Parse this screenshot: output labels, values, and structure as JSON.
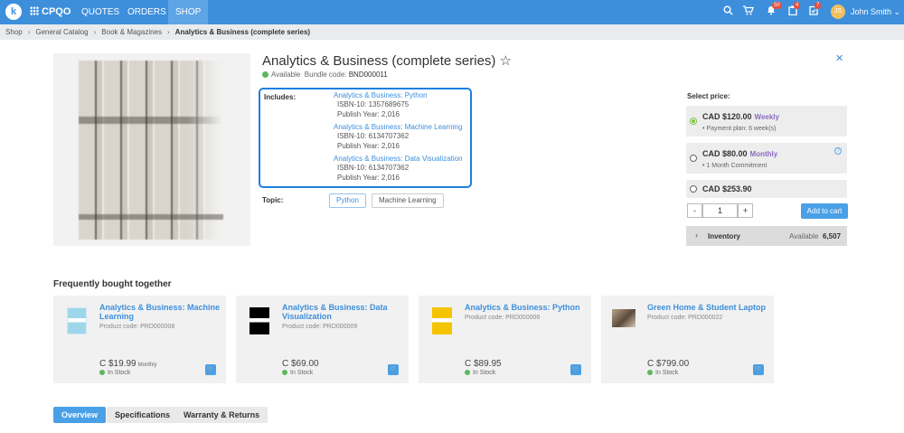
{
  "nav": {
    "logo": "k",
    "app_name": "CPQO",
    "links": [
      "QUOTES",
      "ORDERS",
      "SHOP"
    ],
    "active": "SHOP",
    "badges": {
      "notifications": "50",
      "quotes": "4",
      "tasks": "7"
    },
    "avatar_initials": "JS",
    "user": "John Smith"
  },
  "breadcrumb": [
    "Shop",
    "General Catalog",
    "Book & Magazines",
    "Analytics & Business (complete series)"
  ],
  "product": {
    "title": "Analytics & Business (complete series) ☆",
    "availability": "Available",
    "bundle_code_label": "Bundle code:",
    "bundle_code": "BND000011",
    "includes_label": "Includes:",
    "includes": [
      {
        "name": "Analytics & Business: Python",
        "isbn": "ISBN-10: 1357689675",
        "year": "Publish Year: 2,016"
      },
      {
        "name": "Analytics & Business: Machine Learning",
        "isbn": "ISBN-10: 6134707362",
        "year": "Publish Year: 2,016"
      },
      {
        "name": "Analytics & Business: Data Visualization",
        "isbn": "ISBN-10: 6134707362",
        "year": "Publish Year: 2,016"
      }
    ],
    "topic_label": "Topic:",
    "topics": [
      "Python",
      "Machine Learning"
    ]
  },
  "pricing": {
    "label": "Select price:",
    "options": [
      {
        "amount": "CAD $120.00",
        "period": "Weekly",
        "plan": "Payment plan: 6 week(s)",
        "selected": true
      },
      {
        "amount": "CAD $80.00",
        "period": "Monthly",
        "plan": "1 Month Commitment",
        "selected": false
      },
      {
        "amount": "CAD $253.90",
        "period": "",
        "plan": "",
        "selected": false
      }
    ],
    "qty_minus": "-",
    "qty": "1",
    "qty_plus": "+",
    "add_to_cart": "Add to cart",
    "inventory_label": "Inventory",
    "inventory_available": "Available",
    "inventory_count": "6,507"
  },
  "fbt": {
    "title": "Frequently bought together",
    "items": [
      {
        "name": "Analytics & Business: Machine Learning",
        "code": "Product code: PRD000008",
        "price": "C $19.99",
        "period": "Monthly",
        "stock": "In Stock"
      },
      {
        "name": "Analytics & Business: Data Visualization",
        "code": "Product code: PRD000009",
        "price": "C $69.00",
        "period": "",
        "stock": "In Stock"
      },
      {
        "name": "Analytics & Business: Python",
        "code": "Product code: PRD000006",
        "price": "C $89.95",
        "period": "",
        "stock": "In Stock"
      },
      {
        "name": "Green Home & Student Laptop",
        "code": "Product code: PRD000022",
        "price": "C $799.00",
        "period": "",
        "stock": "In Stock"
      }
    ]
  },
  "tabs": [
    "Overview",
    "Specifications",
    "Warranty & Returns"
  ],
  "colors": {
    "brand": "#3d8fdc",
    "highlight_border": "#1e7fe0",
    "selected_radio": "#7ac142"
  }
}
